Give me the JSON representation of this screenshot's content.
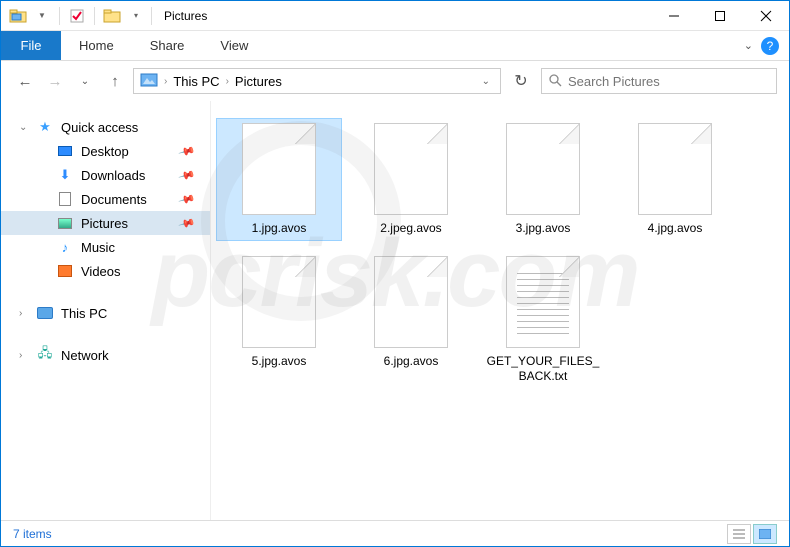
{
  "title": "Pictures",
  "ribbon": {
    "file": "File",
    "tabs": [
      "Home",
      "Share",
      "View"
    ]
  },
  "breadcrumb": {
    "root": "This PC",
    "folder": "Pictures"
  },
  "search": {
    "placeholder": "Search Pictures"
  },
  "sidebar": {
    "quick_access": "Quick access",
    "items": [
      {
        "label": "Desktop",
        "pinned": true
      },
      {
        "label": "Downloads",
        "pinned": true
      },
      {
        "label": "Documents",
        "pinned": true
      },
      {
        "label": "Pictures",
        "pinned": true,
        "selected": true
      },
      {
        "label": "Music",
        "pinned": false
      },
      {
        "label": "Videos",
        "pinned": false
      }
    ],
    "this_pc": "This PC",
    "network": "Network"
  },
  "files": [
    {
      "name": "1.jpg.avos",
      "type": "blank",
      "selected": true
    },
    {
      "name": "2.jpeg.avos",
      "type": "blank"
    },
    {
      "name": "3.jpg.avos",
      "type": "blank"
    },
    {
      "name": "4.jpg.avos",
      "type": "blank"
    },
    {
      "name": "5.jpg.avos",
      "type": "blank"
    },
    {
      "name": "6.jpg.avos",
      "type": "blank"
    },
    {
      "name": "GET_YOUR_FILES_BACK.txt",
      "type": "text"
    }
  ],
  "status": {
    "count": "7 items"
  },
  "watermark": "pcrisk.com"
}
